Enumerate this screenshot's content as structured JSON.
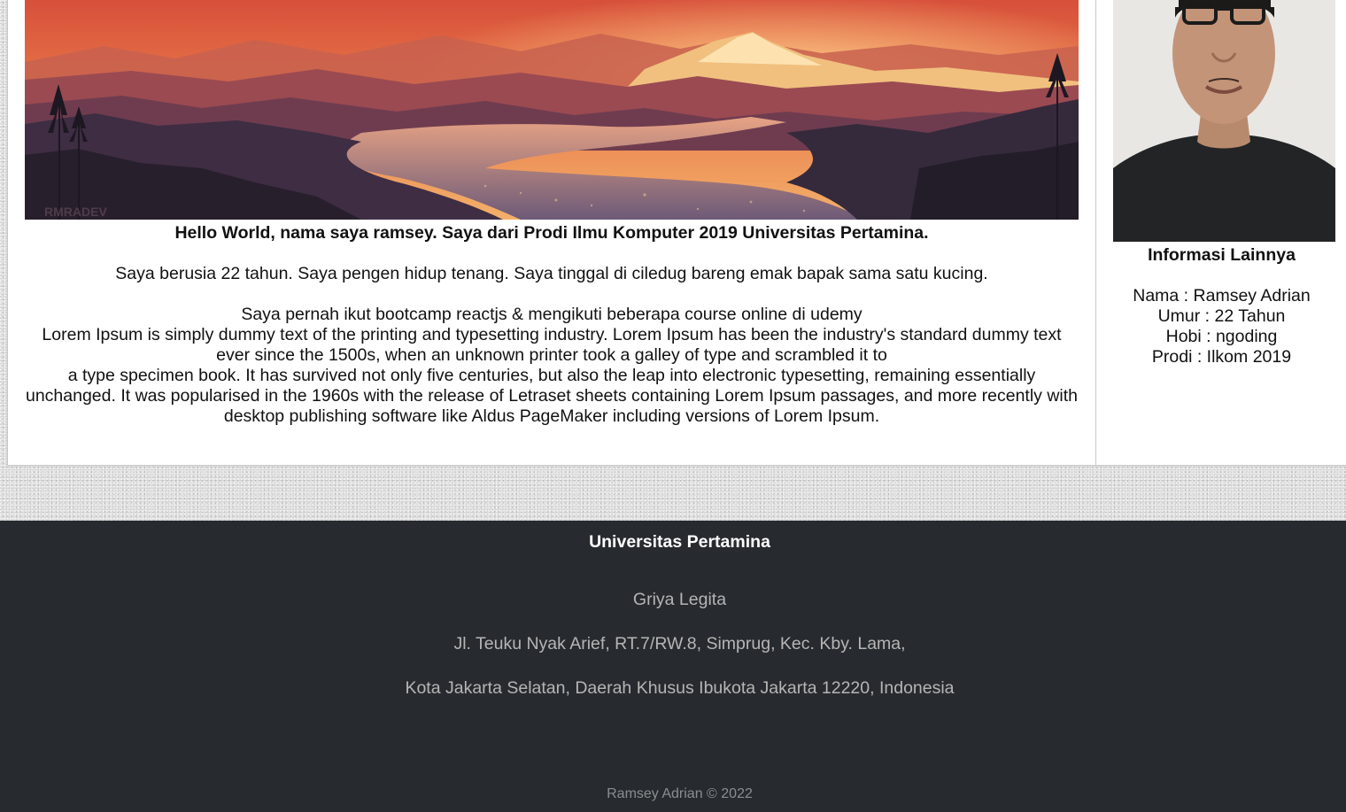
{
  "main": {
    "banner_watermark": "RMRADEV",
    "headline": "Hello World, nama saya ramsey. Saya dari Prodi Ilmu Komputer 2019 Universitas Pertamina.",
    "paragraph_age": "Saya berusia 22 tahun. Saya pengen hidup tenang. Saya tinggal di ciledug bareng emak bapak sama satu kucing.",
    "paragraph_bootcamp": "Saya pernah ikut bootcamp reactjs & mengikuti beberapa course online di udemy",
    "lorem_line_1": "Lorem Ipsum is simply dummy text of the printing and typesetting industry. Lorem Ipsum has been the industry's standard dummy text ever since the 1500s, when an unknown printer took a galley of type and scrambled it to",
    "lorem_line_2": "a type specimen book. It has survived not only five centuries, but also the leap into electronic typesetting, remaining essentially unchanged. It was popularised in the 1960s with the release of Letraset sheets containing Lorem Ipsum passages, and more recently with desktop publishing software like Aldus PageMaker including versions of Lorem Ipsum."
  },
  "sidebar": {
    "title": "Informasi Lainnya",
    "items": [
      {
        "text": "Nama : Ramsey Adrian"
      },
      {
        "text": "Umur : 22 Tahun"
      },
      {
        "text": "Hobi : ngoding"
      },
      {
        "text": "Prodi : Ilkom 2019"
      }
    ]
  },
  "footer": {
    "title": "Universitas Pertamina",
    "address_1": "Griya Legita",
    "address_2": "Jl. Teuku Nyak Arief, RT.7/RW.8, Simprug, Kec. Kby. Lama,",
    "address_3": "Kota Jakarta Selatan, Daerah Khusus Ibukota Jakarta 12220, Indonesia",
    "copyright": "Ramsey Adrian © 2022"
  },
  "colors": {
    "footer_bg": "#272b2f",
    "panel_bg": "#ffffff",
    "page_bg": "#e6e6e6"
  }
}
